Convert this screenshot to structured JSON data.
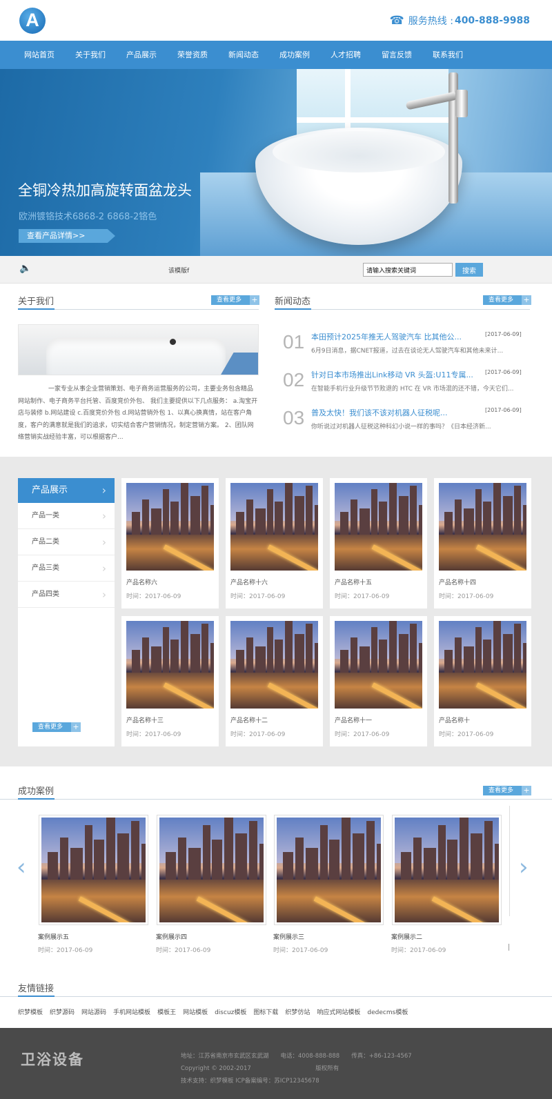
{
  "header": {
    "logo_letter": "A",
    "hotline_label": "服务热线 :",
    "hotline_number": "400-888-9988"
  },
  "nav": [
    "网站首页",
    "关于我们",
    "产品展示",
    "荣誉资质",
    "新闻动态",
    "成功案例",
    "人才招聘",
    "留言反馈",
    "联系我们"
  ],
  "banner": {
    "title": "全铜冷热加高旋转面盆龙头",
    "subtitle": "欧洲镀铬技术6868-2 6868-2铬色",
    "button": "查看产品详情>>",
    "slide_count": 2,
    "active_slide": 2
  },
  "searchbar": {
    "marquee": "该模版f",
    "placeholder": "请输入搜索关键词",
    "button": "搜索"
  },
  "about": {
    "title": "关于我们",
    "more": "查看更多",
    "text": "一家专业从事企业营销策划、电子商务运营服务的公司，主要业务包含精品网站制作、电子商务平台托管、百度竞价外包、 我们主要提供以下几点服务： a.淘宝开店与装修 b.网站建设 c.百度竞价外包 d.网站营销外包 1、以真心换真情，站在客户角度，客户的满意就是我们的追求，切实结合客户营销情况，制定营销方案。 2、团队网络营销实战经验丰富，可以根据客户..."
  },
  "news": {
    "title": "新闻动态",
    "more": "查看更多",
    "items": [
      {
        "num": "01",
        "title": "本田预计2025年推无人驾驶汽车 比其他公...",
        "date": "[2017-06-09]",
        "desc": "6月9日消息，据CNET报道，过去在谈论无人驾驶汽车和其他未来计..."
      },
      {
        "num": "02",
        "title": "针对日本市场推出Link移动 VR 头盔:U11专属...",
        "date": "[2017-06-09]",
        "desc": "在智能手机行业升级节节败退的 HTC 在 VR 市场混的还不错，今天它们..."
      },
      {
        "num": "03",
        "title": "普及太快！我们该不该对机器人征税呢...",
        "date": "[2017-06-09]",
        "desc": "你听说过对机器人征税这种科幻小说一样的事吗？《日本经济新..."
      }
    ]
  },
  "products": {
    "title": "产品展示",
    "categories": [
      "产品一类",
      "产品二类",
      "产品三类",
      "产品四类"
    ],
    "more": "查看更多",
    "items": [
      {
        "name": "产品名称六",
        "time": "时间：2017-06-09"
      },
      {
        "name": "产品名称十六",
        "time": "时间：2017-06-09"
      },
      {
        "name": "产品名称十五",
        "time": "时间：2017-06-09"
      },
      {
        "name": "产品名称十四",
        "time": "时间：2017-06-09"
      },
      {
        "name": "产品名称十三",
        "time": "时间：2017-06-09"
      },
      {
        "name": "产品名称十二",
        "time": "时间：2017-06-09"
      },
      {
        "name": "产品名称十一",
        "time": "时间：2017-06-09"
      },
      {
        "name": "产品名称十",
        "time": "时间：2017-06-09"
      }
    ]
  },
  "cases": {
    "title": "成功案例",
    "more": "查看更多",
    "items": [
      {
        "name": "案例展示五",
        "time": "时间：2017-06-09"
      },
      {
        "name": "案例展示四",
        "time": "时间：2017-06-09"
      },
      {
        "name": "案例展示三",
        "time": "时间：2017-06-09"
      },
      {
        "name": "案例展示二",
        "time": "时间：2017-06-09"
      }
    ]
  },
  "links": {
    "title": "友情链接",
    "items": [
      "织梦模板",
      "织梦源码",
      "网站源码",
      "手机网站模板",
      "模板王",
      "网站模板",
      "discuz模板",
      "图标下载",
      "织梦仿站",
      "响应式网站模板",
      "dedecms模板"
    ]
  },
  "footer": {
    "logo": "卫浴设备",
    "line1": "地址：江苏省南京市玄武区玄武湖　　电话：4008-888-888　　传真：+86-123-4567",
    "line2": "Copyright © 2002-2017　　　　　　　　　　　版权所有",
    "line3": "技术支持：织梦模板 ICP备案编号：苏ICP12345678"
  }
}
